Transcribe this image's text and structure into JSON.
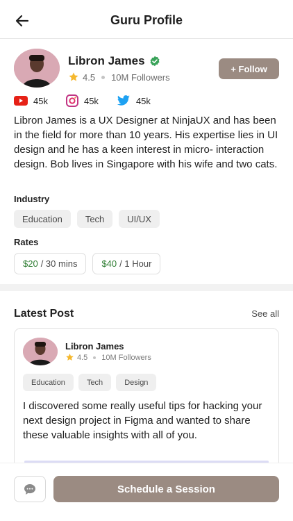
{
  "header": {
    "title": "Guru Profile",
    "back_icon": "arrow-left-icon"
  },
  "profile": {
    "name": "Libron James",
    "rating": "4.5",
    "followers": "10M Followers",
    "follow_label": "+ Follow",
    "verified_icon": "verified-badge-icon",
    "socials": [
      {
        "icon": "youtube-icon",
        "count": "45k",
        "color": "#e62117"
      },
      {
        "icon": "instagram-icon",
        "count": "45k",
        "color": "#c13584"
      },
      {
        "icon": "twitter-icon",
        "count": "45k",
        "color": "#1da1f2"
      }
    ],
    "bio": "Libron James is a UX Designer at NinjaUX and has been in the field for more than 10 years. His expertise lies in UI design and he has a keen interest in micro- interaction design. Bob lives in Singapore with his wife and two cats."
  },
  "industry": {
    "label": "Industry",
    "chips": [
      "Education",
      "Tech",
      "UI/UX"
    ]
  },
  "rates": {
    "label": "Rates",
    "items": [
      {
        "price": "$20",
        "unit": "/ 30 mins"
      },
      {
        "price": "$40",
        "unit": "/ 1 Hour"
      }
    ]
  },
  "latest_post": {
    "title": "Latest Post",
    "see_all": "See all",
    "author": "Libron James",
    "rating": "4.5",
    "followers": "10M Followers",
    "chips": [
      "Education",
      "Tech",
      "Design"
    ],
    "text": "I discovered some really useful tips for hacking your next design project in Figma and wanted to share these valuable insights with all of you."
  },
  "footer": {
    "chat_icon": "chat-bubble-icon",
    "schedule_label": "Schedule a Session"
  },
  "colors": {
    "accent": "#9b8b82",
    "price_green": "#2e7d32",
    "star": "#f5b82e",
    "verified": "#3aa35a"
  }
}
